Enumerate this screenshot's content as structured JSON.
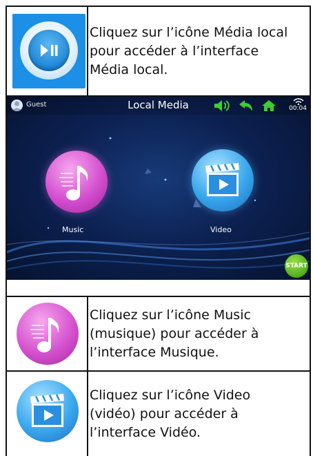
{
  "rows": [
    {
      "icon": "local-media-icon",
      "text": [
        "Cliquez sur l’icône Média local",
        "pour accéder à l’interface",
        "Média local."
      ]
    },
    {
      "icon": "screenshot"
    },
    {
      "icon": "music-icon",
      "text": [
        "Cliquez sur l’icône Music",
        "(musique) pour accéder à",
        "l’interface Musique."
      ]
    },
    {
      "icon": "video-icon",
      "text": [
        "Cliquez sur l’icône Video",
        "(vidéo) pour accéder à",
        "l’interface Vidéo."
      ]
    }
  ],
  "screen": {
    "user": "Guest",
    "title": "Local Media",
    "time": "00:04",
    "apps": [
      {
        "label": "Music",
        "icon": "music-note-icon",
        "color": "#d34fcf"
      },
      {
        "label": "Video",
        "icon": "clapperboard-icon",
        "color": "#38a6ec"
      }
    ],
    "status_icons": [
      "volume-icon",
      "back-icon",
      "home-icon",
      "wifi-icon"
    ],
    "start_label": "START"
  },
  "colors": {
    "media_tile": "#1c8fe6",
    "screen_bg": "#0c2050",
    "status_green": "#3ccf2e",
    "border": "#111111"
  }
}
